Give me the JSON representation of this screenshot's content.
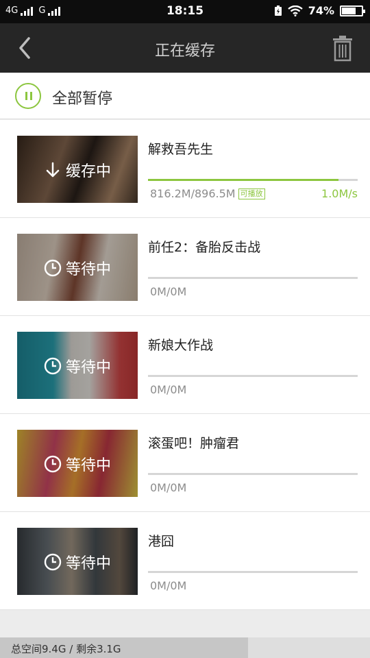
{
  "status": {
    "net1": "4G",
    "net2": "G",
    "time": "18:15",
    "battery": "74%",
    "battery_level": 0.74
  },
  "nav": {
    "title": "正在缓存"
  },
  "pause_all": {
    "label": "全部暂停"
  },
  "downloads": [
    {
      "title": "解救吾先生",
      "state": "缓存中",
      "state_icon": "download-arrow-icon",
      "progress": 0.91,
      "size": "816.2M/896.5M",
      "badge": "可播放",
      "speed": "1.0M/s"
    },
    {
      "title": "前任2：备胎反击战",
      "state": "等待中",
      "state_icon": "clock-icon",
      "progress": 0,
      "size": "0M/0M"
    },
    {
      "title": "新娘大作战",
      "state": "等待中",
      "state_icon": "clock-icon",
      "progress": 0,
      "size": "0M/0M"
    },
    {
      "title": "滚蛋吧！肿瘤君",
      "state": "等待中",
      "state_icon": "clock-icon",
      "progress": 0,
      "size": "0M/0M"
    },
    {
      "title": "港囧",
      "state": "等待中",
      "state_icon": "clock-icon",
      "progress": 0,
      "size": "0M/0M"
    }
  ],
  "footer": {
    "storage": "总空间9.4G / 剩余3.1G",
    "used_fraction": 0.67
  },
  "colors": {
    "accent": "#8cc63f",
    "navbar": "#262626",
    "statusbar": "#0d0d0d"
  }
}
